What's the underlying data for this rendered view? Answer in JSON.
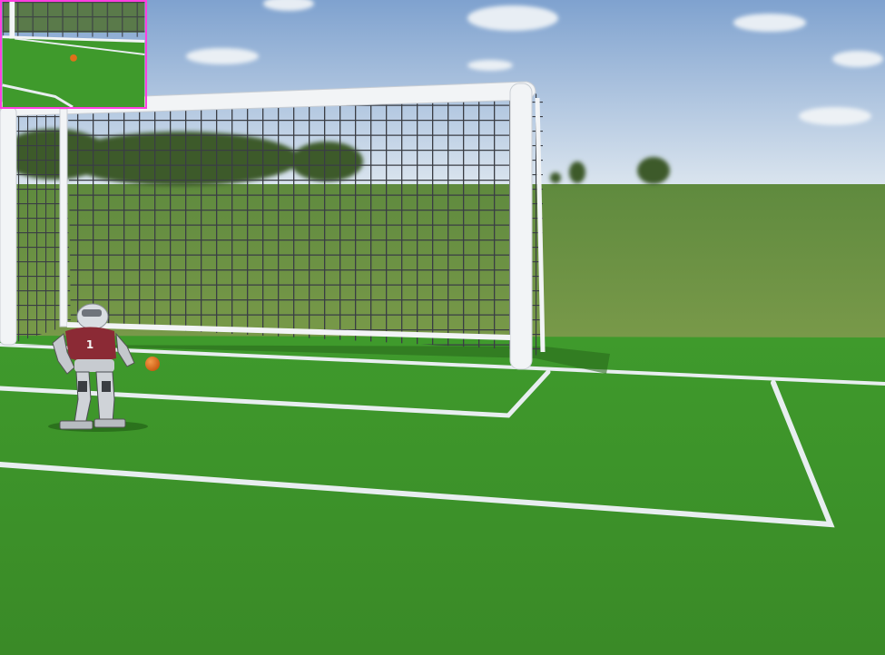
{
  "scene": {
    "type": "robot-soccer-simulation",
    "robot": {
      "jersey_number": "1",
      "jersey_color": "#8b2a35"
    },
    "ball": {
      "color": "#e0701a"
    },
    "minimap": {
      "border_color": "#ff3fe0"
    },
    "colors": {
      "sky_top": "#8fb0d8",
      "sky_bottom": "#d9e4ee",
      "far_field": "#6a8f45",
      "pitch": "#3d8f2a",
      "line": "#e8eef0",
      "goal_frame": "#f2f4f6",
      "net": "#3a3d44"
    }
  }
}
